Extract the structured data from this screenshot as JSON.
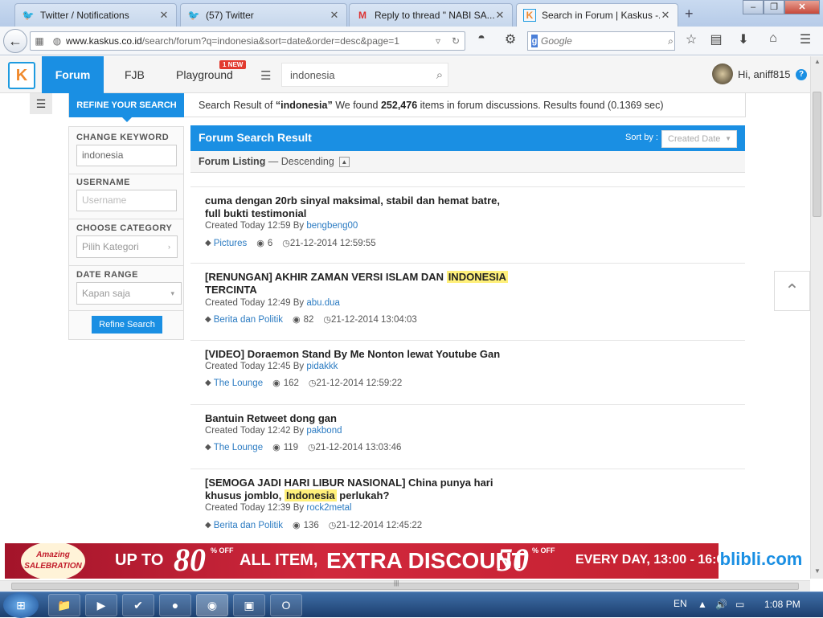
{
  "browser": {
    "tabs": [
      {
        "title": "Twitter / Notifications",
        "icon": "twitter-icon"
      },
      {
        "title": "(57) Twitter",
        "icon": "twitter-icon"
      },
      {
        "title": "Reply to thread \" NABI SA...",
        "icon": "gmail-icon"
      },
      {
        "title": "Search in Forum | Kaskus -...",
        "icon": "kaskus-icon"
      }
    ],
    "url_domain": "www.kaskus.co.id",
    "url_path": "/search/forum?q=indonesia&sort=date&order=desc&page=1",
    "search_placeholder": "Google"
  },
  "site": {
    "logo": "K",
    "nav": {
      "forum": "Forum",
      "fjb": "FJB",
      "playground": "Playground",
      "badge": "1 NEW"
    },
    "search_value": "indonesia",
    "greeting": "Hi, aniff815",
    "help": "?"
  },
  "refine": {
    "tab_label": "REFINE YOUR SEARCH",
    "results_prefix": "Search Result of ",
    "results_query": "“indonesia”",
    "results_mid": " We found ",
    "results_count": "252,476",
    "results_suffix": " items in forum discussions. Results found (0.1369 sec)",
    "change_keyword_label": "CHANGE KEYWORD",
    "keyword_value": "indonesia",
    "username_label": "USERNAME",
    "username_placeholder": "Username",
    "category_label": "CHOOSE CATEGORY",
    "category_value": "Pilih Kategori",
    "date_label": "DATE RANGE",
    "date_value": "Kapan saja",
    "button": "Refine Search"
  },
  "results_header": {
    "title": "Forum Search Result",
    "sort_label": "Sort by :",
    "sort_value": "Created Date",
    "listing_label": "Forum Listing",
    "listing_order": " — Descending"
  },
  "results": [
    {
      "title_before": "cuma dengan 20rb sinyal maksimal, stabil dan hemat batre, full bukti testimonial",
      "highlight": "",
      "title_after": "",
      "created": "Created Today 12:59 By ",
      "author": "bengbeng00",
      "category": "Pictures",
      "views": "6",
      "date": "21-12-2014 12:59:55"
    },
    {
      "title_before": "[RENUNGAN] AKHIR ZAMAN VERSI ISLAM DAN ",
      "highlight": "INDONESIA",
      "title_after": " TERCINTA",
      "created": "Created Today 12:49 By ",
      "author": "abu.dua",
      "category": "Berita dan Politik",
      "views": "82",
      "date": "21-12-2014 13:04:03"
    },
    {
      "title_before": "[VIDEO] Doraemon Stand By Me Nonton lewat Youtube Gan",
      "highlight": "",
      "title_after": "",
      "created": "Created Today 12:45 By ",
      "author": "pidakkk",
      "category": "The Lounge",
      "views": "162",
      "date": "21-12-2014 12:59:22"
    },
    {
      "title_before": "Bantuin Retweet dong gan",
      "highlight": "",
      "title_after": "",
      "created": "Created Today 12:42 By ",
      "author": "pakbond",
      "category": "The Lounge",
      "views": "119",
      "date": "21-12-2014 13:03:46"
    },
    {
      "title_before": "[SEMOGA JADI HARI LIBUR NASIONAL] China punya hari khusus jomblo, ",
      "highlight": "Indonesia",
      "title_after": " perlukah?",
      "created": "Created Today 12:39 By ",
      "author": "rock2metal",
      "category": "Berita dan Politik",
      "views": "136",
      "date": "21-12-2014 12:45:22"
    }
  ],
  "ad": {
    "logo": "Amazing SALEBRATION",
    "up_to": "UP TO",
    "pct1": "80",
    "off1": "% OFF",
    "all_item": "ALL ITEM,",
    "extra": "EXTRA DISCOUNT",
    "pct2": "50",
    "off2": "% OFF",
    "every_day": "EVERY DAY, 13:00 - 16:00",
    "brand": "blibli.com"
  },
  "taskbar": {
    "lang": "EN",
    "time": "1:08 PM"
  },
  "colors": {
    "accent": "#1a8fe3",
    "highlight": "#fff07a",
    "badge": "#e23b2f"
  }
}
